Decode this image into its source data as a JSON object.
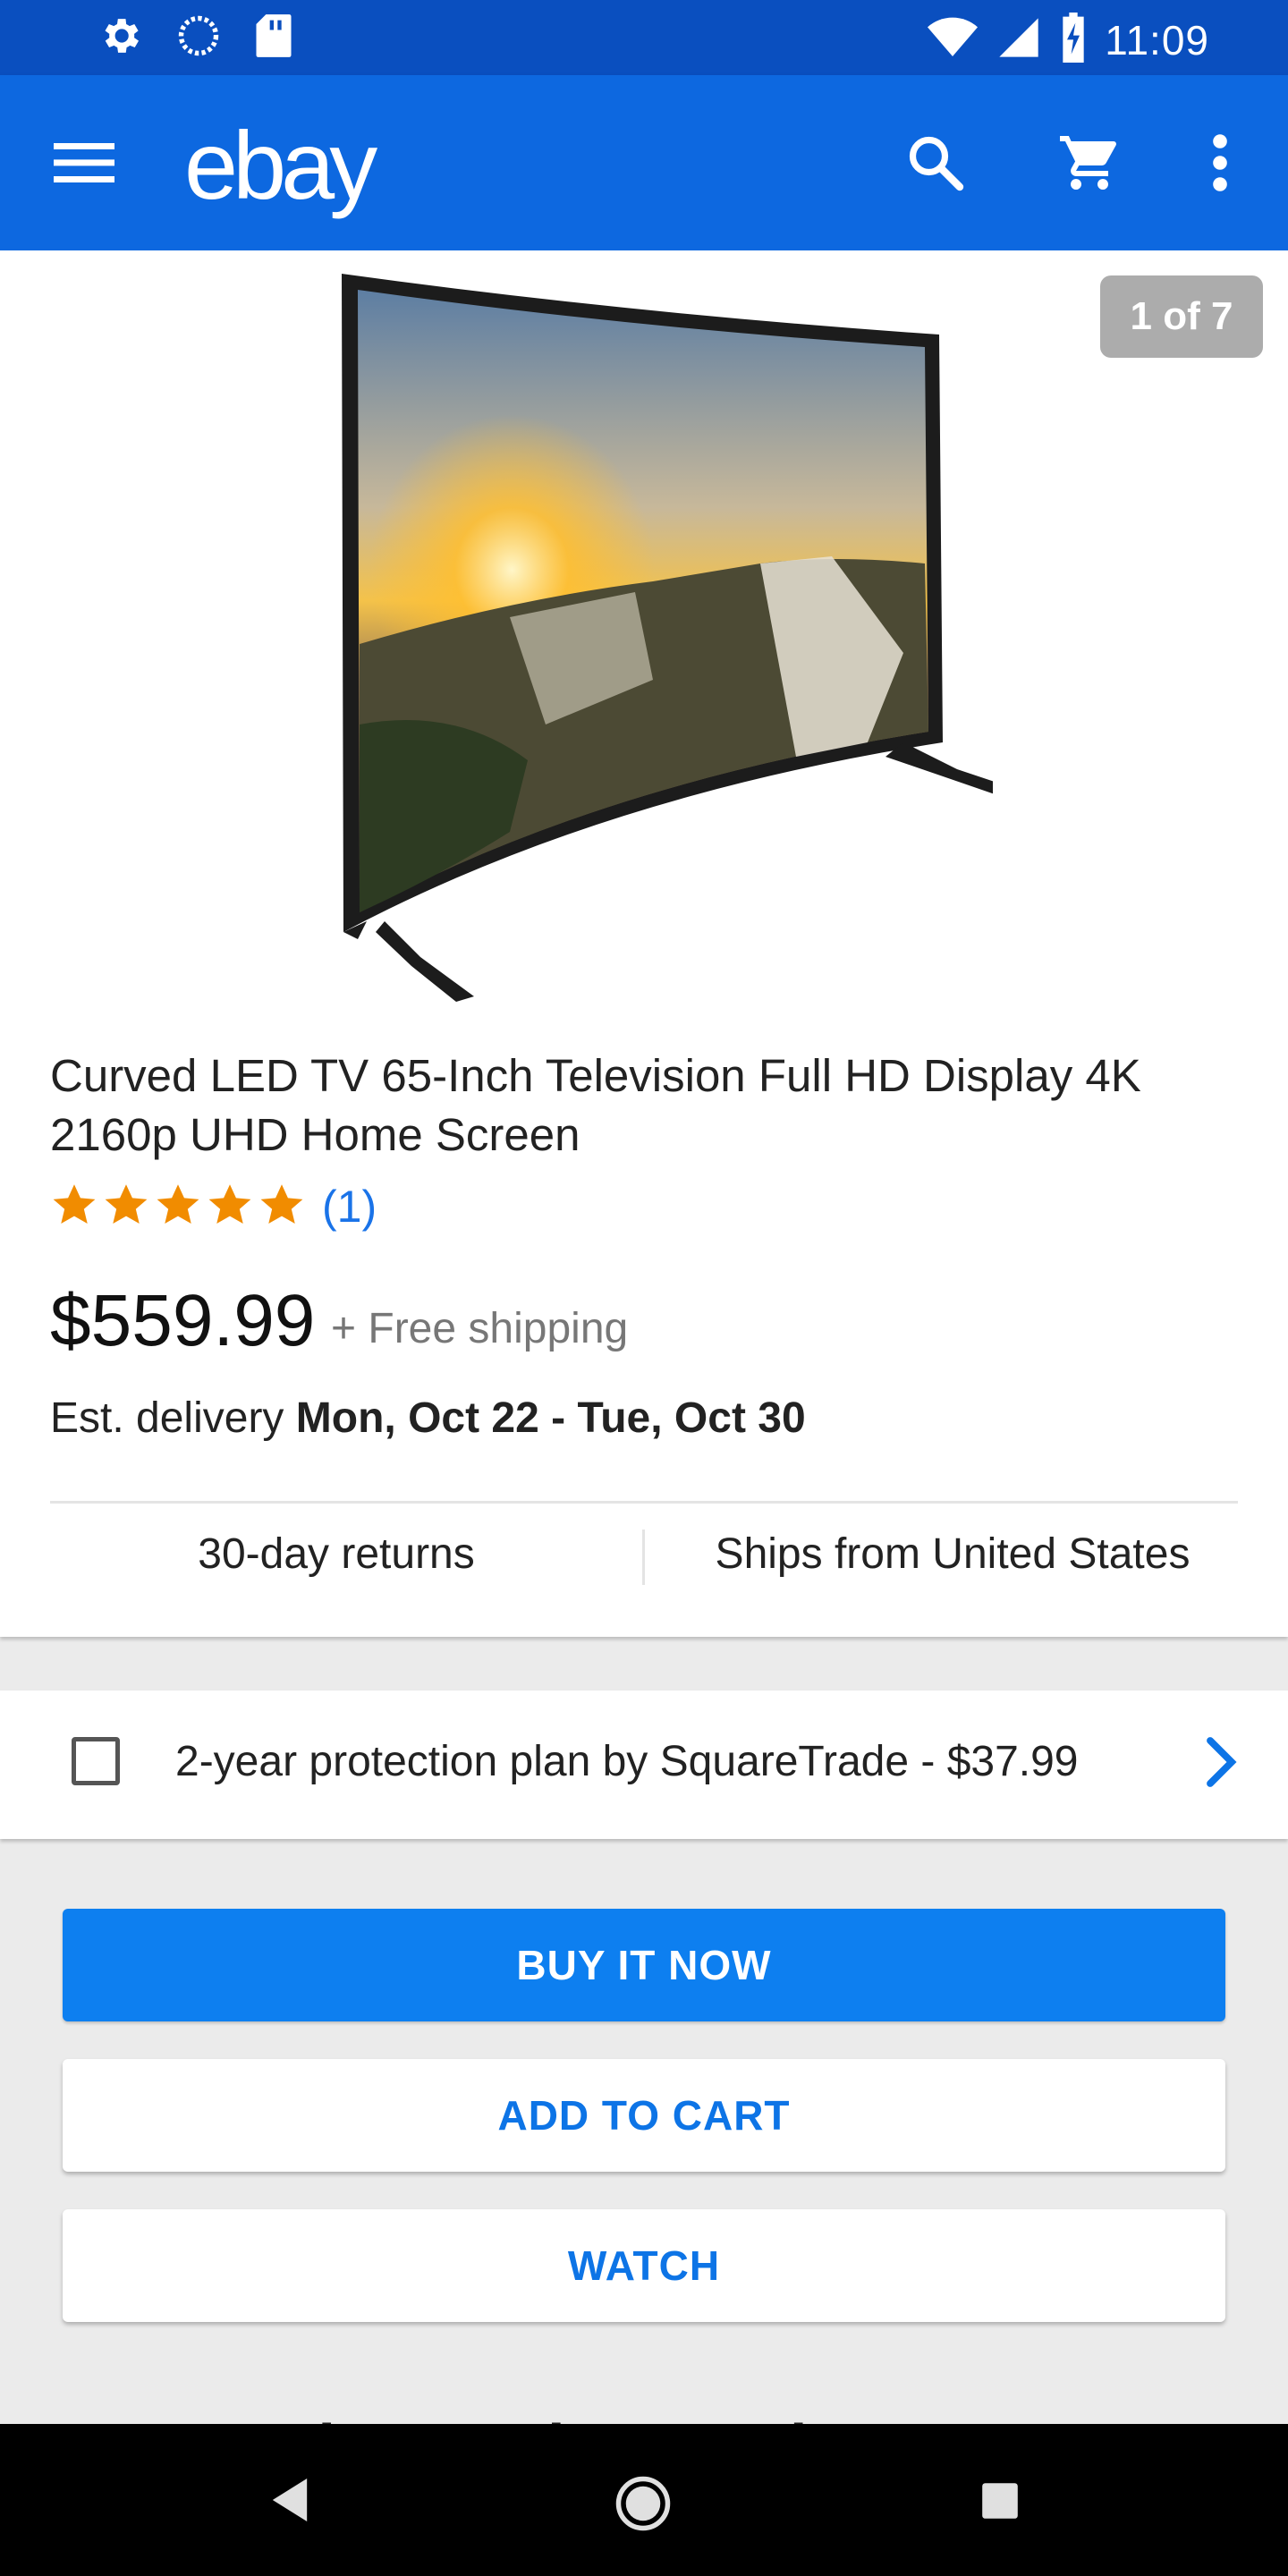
{
  "status_bar": {
    "time": "11:09",
    "left_icons": [
      "gear-icon",
      "sync-icon",
      "sd-card-icon"
    ],
    "right_icons": [
      "wifi-icon",
      "signal-icon",
      "battery-charging-icon"
    ]
  },
  "app_bar": {
    "logo": "ebay",
    "icons": [
      "menu-icon",
      "search-icon",
      "cart-icon",
      "more-vert-icon"
    ],
    "color": "#0d68e0"
  },
  "product": {
    "image_counter": "1 of 7",
    "title": "Curved LED TV 65-Inch Television Full HD Display 4K 2160p UHD Home Screen",
    "rating_stars": 5,
    "rating_count": "(1)",
    "price": "$559.99",
    "shipping": "+ Free shipping",
    "delivery_prefix": "Est. delivery ",
    "delivery_dates": "Mon, Oct 22 - Tue, Oct 30",
    "returns": "30-day returns",
    "ships_from": "Ships from United States",
    "star_color": "#f18c00"
  },
  "protection_plan": {
    "label": "2-year protection plan by SquareTrade - $37.99",
    "checked": false
  },
  "actions": {
    "buy_now": "BUY IT NOW",
    "add_to_cart": "ADD TO CART",
    "watch": "WATCH"
  },
  "next_section_title_partial": "Frequently Bought Together"
}
